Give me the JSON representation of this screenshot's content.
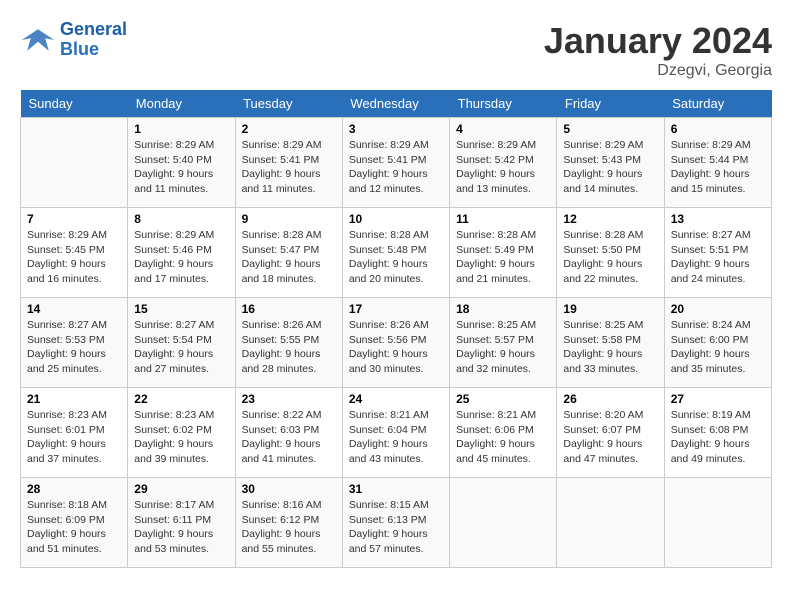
{
  "logo": {
    "line1": "General",
    "line2": "Blue"
  },
  "title": "January 2024",
  "location": "Dzegvi, Georgia",
  "days_header": [
    "Sunday",
    "Monday",
    "Tuesday",
    "Wednesday",
    "Thursday",
    "Friday",
    "Saturday"
  ],
  "weeks": [
    [
      {
        "day": "",
        "sunrise": "",
        "sunset": "",
        "daylight": ""
      },
      {
        "day": "1",
        "sunrise": "Sunrise: 8:29 AM",
        "sunset": "Sunset: 5:40 PM",
        "daylight": "Daylight: 9 hours and 11 minutes."
      },
      {
        "day": "2",
        "sunrise": "Sunrise: 8:29 AM",
        "sunset": "Sunset: 5:41 PM",
        "daylight": "Daylight: 9 hours and 11 minutes."
      },
      {
        "day": "3",
        "sunrise": "Sunrise: 8:29 AM",
        "sunset": "Sunset: 5:41 PM",
        "daylight": "Daylight: 9 hours and 12 minutes."
      },
      {
        "day": "4",
        "sunrise": "Sunrise: 8:29 AM",
        "sunset": "Sunset: 5:42 PM",
        "daylight": "Daylight: 9 hours and 13 minutes."
      },
      {
        "day": "5",
        "sunrise": "Sunrise: 8:29 AM",
        "sunset": "Sunset: 5:43 PM",
        "daylight": "Daylight: 9 hours and 14 minutes."
      },
      {
        "day": "6",
        "sunrise": "Sunrise: 8:29 AM",
        "sunset": "Sunset: 5:44 PM",
        "daylight": "Daylight: 9 hours and 15 minutes."
      }
    ],
    [
      {
        "day": "7",
        "sunrise": "Sunrise: 8:29 AM",
        "sunset": "Sunset: 5:45 PM",
        "daylight": "Daylight: 9 hours and 16 minutes."
      },
      {
        "day": "8",
        "sunrise": "Sunrise: 8:29 AM",
        "sunset": "Sunset: 5:46 PM",
        "daylight": "Daylight: 9 hours and 17 minutes."
      },
      {
        "day": "9",
        "sunrise": "Sunrise: 8:28 AM",
        "sunset": "Sunset: 5:47 PM",
        "daylight": "Daylight: 9 hours and 18 minutes."
      },
      {
        "day": "10",
        "sunrise": "Sunrise: 8:28 AM",
        "sunset": "Sunset: 5:48 PM",
        "daylight": "Daylight: 9 hours and 20 minutes."
      },
      {
        "day": "11",
        "sunrise": "Sunrise: 8:28 AM",
        "sunset": "Sunset: 5:49 PM",
        "daylight": "Daylight: 9 hours and 21 minutes."
      },
      {
        "day": "12",
        "sunrise": "Sunrise: 8:28 AM",
        "sunset": "Sunset: 5:50 PM",
        "daylight": "Daylight: 9 hours and 22 minutes."
      },
      {
        "day": "13",
        "sunrise": "Sunrise: 8:27 AM",
        "sunset": "Sunset: 5:51 PM",
        "daylight": "Daylight: 9 hours and 24 minutes."
      }
    ],
    [
      {
        "day": "14",
        "sunrise": "Sunrise: 8:27 AM",
        "sunset": "Sunset: 5:53 PM",
        "daylight": "Daylight: 9 hours and 25 minutes."
      },
      {
        "day": "15",
        "sunrise": "Sunrise: 8:27 AM",
        "sunset": "Sunset: 5:54 PM",
        "daylight": "Daylight: 9 hours and 27 minutes."
      },
      {
        "day": "16",
        "sunrise": "Sunrise: 8:26 AM",
        "sunset": "Sunset: 5:55 PM",
        "daylight": "Daylight: 9 hours and 28 minutes."
      },
      {
        "day": "17",
        "sunrise": "Sunrise: 8:26 AM",
        "sunset": "Sunset: 5:56 PM",
        "daylight": "Daylight: 9 hours and 30 minutes."
      },
      {
        "day": "18",
        "sunrise": "Sunrise: 8:25 AM",
        "sunset": "Sunset: 5:57 PM",
        "daylight": "Daylight: 9 hours and 32 minutes."
      },
      {
        "day": "19",
        "sunrise": "Sunrise: 8:25 AM",
        "sunset": "Sunset: 5:58 PM",
        "daylight": "Daylight: 9 hours and 33 minutes."
      },
      {
        "day": "20",
        "sunrise": "Sunrise: 8:24 AM",
        "sunset": "Sunset: 6:00 PM",
        "daylight": "Daylight: 9 hours and 35 minutes."
      }
    ],
    [
      {
        "day": "21",
        "sunrise": "Sunrise: 8:23 AM",
        "sunset": "Sunset: 6:01 PM",
        "daylight": "Daylight: 9 hours and 37 minutes."
      },
      {
        "day": "22",
        "sunrise": "Sunrise: 8:23 AM",
        "sunset": "Sunset: 6:02 PM",
        "daylight": "Daylight: 9 hours and 39 minutes."
      },
      {
        "day": "23",
        "sunrise": "Sunrise: 8:22 AM",
        "sunset": "Sunset: 6:03 PM",
        "daylight": "Daylight: 9 hours and 41 minutes."
      },
      {
        "day": "24",
        "sunrise": "Sunrise: 8:21 AM",
        "sunset": "Sunset: 6:04 PM",
        "daylight": "Daylight: 9 hours and 43 minutes."
      },
      {
        "day": "25",
        "sunrise": "Sunrise: 8:21 AM",
        "sunset": "Sunset: 6:06 PM",
        "daylight": "Daylight: 9 hours and 45 minutes."
      },
      {
        "day": "26",
        "sunrise": "Sunrise: 8:20 AM",
        "sunset": "Sunset: 6:07 PM",
        "daylight": "Daylight: 9 hours and 47 minutes."
      },
      {
        "day": "27",
        "sunrise": "Sunrise: 8:19 AM",
        "sunset": "Sunset: 6:08 PM",
        "daylight": "Daylight: 9 hours and 49 minutes."
      }
    ],
    [
      {
        "day": "28",
        "sunrise": "Sunrise: 8:18 AM",
        "sunset": "Sunset: 6:09 PM",
        "daylight": "Daylight: 9 hours and 51 minutes."
      },
      {
        "day": "29",
        "sunrise": "Sunrise: 8:17 AM",
        "sunset": "Sunset: 6:11 PM",
        "daylight": "Daylight: 9 hours and 53 minutes."
      },
      {
        "day": "30",
        "sunrise": "Sunrise: 8:16 AM",
        "sunset": "Sunset: 6:12 PM",
        "daylight": "Daylight: 9 hours and 55 minutes."
      },
      {
        "day": "31",
        "sunrise": "Sunrise: 8:15 AM",
        "sunset": "Sunset: 6:13 PM",
        "daylight": "Daylight: 9 hours and 57 minutes."
      },
      {
        "day": "",
        "sunrise": "",
        "sunset": "",
        "daylight": ""
      },
      {
        "day": "",
        "sunrise": "",
        "sunset": "",
        "daylight": ""
      },
      {
        "day": "",
        "sunrise": "",
        "sunset": "",
        "daylight": ""
      }
    ]
  ]
}
